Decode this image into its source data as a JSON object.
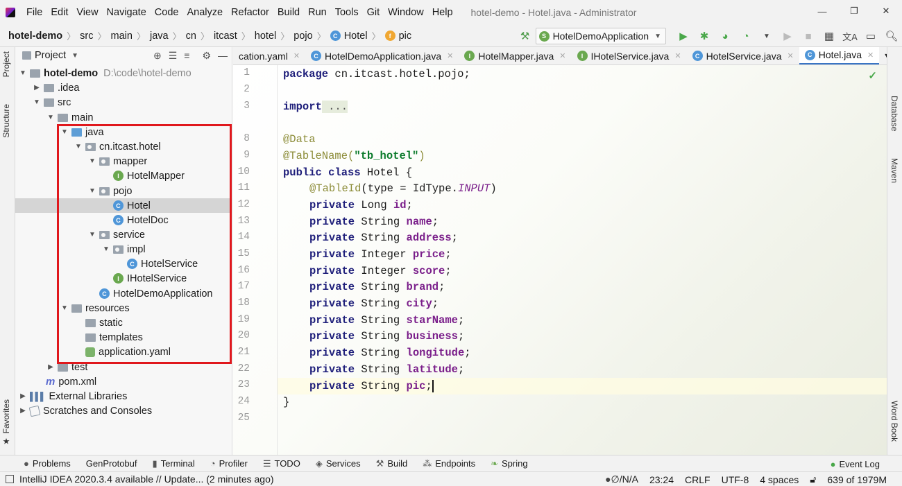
{
  "menubar": {
    "items": [
      "File",
      "Edit",
      "View",
      "Navigate",
      "Code",
      "Analyze",
      "Refactor",
      "Build",
      "Run",
      "Tools",
      "Git",
      "Window",
      "Help"
    ],
    "title": "hotel-demo - Hotel.java - Administrator"
  },
  "breadcrumb": [
    "hotel-demo",
    "src",
    "main",
    "java",
    "cn",
    "itcast",
    "hotel",
    "pojo",
    "Hotel",
    "pic"
  ],
  "run_config": "HotelDemoApplication",
  "left_strip": {
    "project": "Project",
    "structure": "Structure",
    "favorites": "Favorites"
  },
  "right_strip": {
    "database": "Database",
    "maven": "Maven",
    "wordbook": "Word Book"
  },
  "project_panel": {
    "title": "Project",
    "root_name": "hotel-demo",
    "root_path": "D:\\code\\hotel-demo",
    "items": [
      ".idea",
      "src",
      "main",
      "java",
      "cn.itcast.hotel",
      "mapper",
      "HotelMapper",
      "pojo",
      "Hotel",
      "HotelDoc",
      "service",
      "impl",
      "HotelService",
      "IHotelService",
      "HotelDemoApplication",
      "resources",
      "static",
      "templates",
      "application.yaml",
      "test",
      "pom.xml",
      "External Libraries",
      "Scratches and Consoles"
    ]
  },
  "editor_tabs": [
    "cation.yaml",
    "HotelDemoApplication.java",
    "HotelMapper.java",
    "IHotelService.java",
    "HotelService.java",
    "Hotel.java"
  ],
  "editor": {
    "line_numbers": [
      "1",
      "2",
      "3",
      "8",
      "9",
      "10",
      "11",
      "12",
      "13",
      "14",
      "15",
      "16",
      "17",
      "18",
      "19",
      "20",
      "21",
      "22",
      "23",
      "24",
      "25"
    ],
    "code": {
      "package_kw": "package",
      "package_name": " cn.itcast.hotel.pojo;",
      "import_kw": "import",
      "import_fold": " ...",
      "data_ann": "@Data",
      "tablename_ann": "@TableName(",
      "tablename_str": "\"tb_hotel\"",
      "tablename_close": ")",
      "class_kw": "public class",
      "class_rest": " Hotel {",
      "tableid_ann": "@TableId",
      "tableid_args": "(type = IdType.",
      "tableid_const": "INPUT",
      "tableid_close": ")",
      "private_kw": "private",
      "fields": [
        {
          "type": " Long ",
          "name": "id"
        },
        {
          "type": " String ",
          "name": "name"
        },
        {
          "type": " String ",
          "name": "address"
        },
        {
          "type": " Integer ",
          "name": "price"
        },
        {
          "type": " Integer ",
          "name": "score"
        },
        {
          "type": " String ",
          "name": "brand"
        },
        {
          "type": " String ",
          "name": "city"
        },
        {
          "type": " String ",
          "name": "starName"
        },
        {
          "type": " String ",
          "name": "business"
        },
        {
          "type": " String ",
          "name": "longitude"
        },
        {
          "type": " String ",
          "name": "latitude"
        },
        {
          "type": " String ",
          "name": "pic"
        }
      ],
      "semicolon": ";",
      "closing_brace": "}"
    }
  },
  "tool_windows": [
    "Problems",
    "GenProtobuf",
    "Terminal",
    "Profiler",
    "TODO",
    "Services",
    "Build",
    "Endpoints",
    "Spring"
  ],
  "event_log": "Event Log",
  "status": {
    "message": "IntelliJ IDEA 2020.3.4 available // Update... (2 minutes ago)",
    "na": "∅/N/A",
    "position": "23:24",
    "line_sep": "CRLF",
    "encoding": "UTF-8",
    "indent": "4 spaces",
    "memory": "639 of 1979M"
  },
  "colors": {
    "highlight_box": "#e0181d",
    "active_tab": "#3a75c4",
    "selected_row": "#d5d5d5"
  }
}
